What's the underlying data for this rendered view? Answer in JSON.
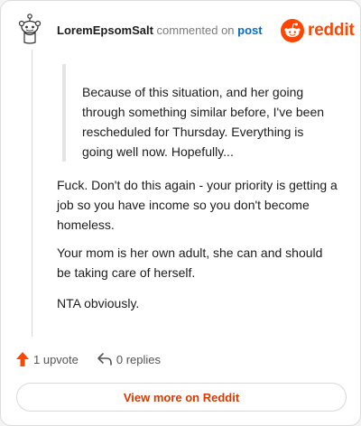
{
  "comment": {
    "username": "LoremEpsomSalt",
    "commented_on": "commented on",
    "post_link": "post",
    "quote": "Because of this situation, and her going through something similar before, I've been rescheduled for Thursday. Everything is going well now. Hopefully...",
    "paragraphs": [
      "Fuck. Don't do this again - your priority is getting a job so you have income so you don't become homeless.",
      "Your mom is her own adult, she can and should be taking care of herself.",
      "NTA obviously."
    ]
  },
  "brand": {
    "name": "reddit",
    "icon": "reddit-logo-icon",
    "color": "#ff4500"
  },
  "actions": {
    "upvote_label": "1 upvote",
    "upvote_icon": "upvote-arrow-icon",
    "upvote_color": "#ff4500",
    "replies_label": "0 replies",
    "replies_icon": "reply-arrow-icon"
  },
  "footer": {
    "view_more_label": "View more on Reddit"
  }
}
